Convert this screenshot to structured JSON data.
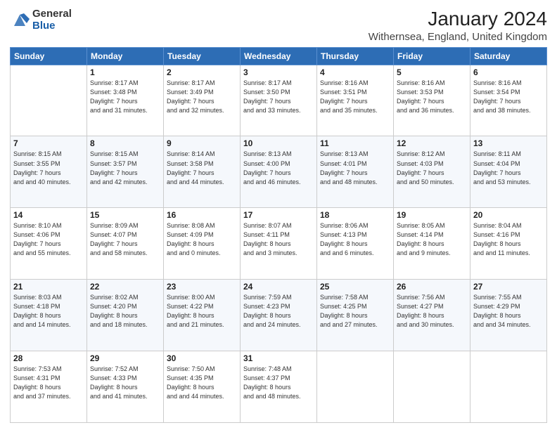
{
  "header": {
    "logo_general": "General",
    "logo_blue": "Blue",
    "month_year": "January 2024",
    "location": "Withernsea, England, United Kingdom"
  },
  "weekdays": [
    "Sunday",
    "Monday",
    "Tuesday",
    "Wednesday",
    "Thursday",
    "Friday",
    "Saturday"
  ],
  "weeks": [
    [
      {
        "day": "",
        "sunrise": "",
        "sunset": "",
        "daylight": ""
      },
      {
        "day": "1",
        "sunrise": "Sunrise: 8:17 AM",
        "sunset": "Sunset: 3:48 PM",
        "daylight": "Daylight: 7 hours and 31 minutes."
      },
      {
        "day": "2",
        "sunrise": "Sunrise: 8:17 AM",
        "sunset": "Sunset: 3:49 PM",
        "daylight": "Daylight: 7 hours and 32 minutes."
      },
      {
        "day": "3",
        "sunrise": "Sunrise: 8:17 AM",
        "sunset": "Sunset: 3:50 PM",
        "daylight": "Daylight: 7 hours and 33 minutes."
      },
      {
        "day": "4",
        "sunrise": "Sunrise: 8:16 AM",
        "sunset": "Sunset: 3:51 PM",
        "daylight": "Daylight: 7 hours and 35 minutes."
      },
      {
        "day": "5",
        "sunrise": "Sunrise: 8:16 AM",
        "sunset": "Sunset: 3:53 PM",
        "daylight": "Daylight: 7 hours and 36 minutes."
      },
      {
        "day": "6",
        "sunrise": "Sunrise: 8:16 AM",
        "sunset": "Sunset: 3:54 PM",
        "daylight": "Daylight: 7 hours and 38 minutes."
      }
    ],
    [
      {
        "day": "7",
        "sunrise": "Sunrise: 8:15 AM",
        "sunset": "Sunset: 3:55 PM",
        "daylight": "Daylight: 7 hours and 40 minutes."
      },
      {
        "day": "8",
        "sunrise": "Sunrise: 8:15 AM",
        "sunset": "Sunset: 3:57 PM",
        "daylight": "Daylight: 7 hours and 42 minutes."
      },
      {
        "day": "9",
        "sunrise": "Sunrise: 8:14 AM",
        "sunset": "Sunset: 3:58 PM",
        "daylight": "Daylight: 7 hours and 44 minutes."
      },
      {
        "day": "10",
        "sunrise": "Sunrise: 8:13 AM",
        "sunset": "Sunset: 4:00 PM",
        "daylight": "Daylight: 7 hours and 46 minutes."
      },
      {
        "day": "11",
        "sunrise": "Sunrise: 8:13 AM",
        "sunset": "Sunset: 4:01 PM",
        "daylight": "Daylight: 7 hours and 48 minutes."
      },
      {
        "day": "12",
        "sunrise": "Sunrise: 8:12 AM",
        "sunset": "Sunset: 4:03 PM",
        "daylight": "Daylight: 7 hours and 50 minutes."
      },
      {
        "day": "13",
        "sunrise": "Sunrise: 8:11 AM",
        "sunset": "Sunset: 4:04 PM",
        "daylight": "Daylight: 7 hours and 53 minutes."
      }
    ],
    [
      {
        "day": "14",
        "sunrise": "Sunrise: 8:10 AM",
        "sunset": "Sunset: 4:06 PM",
        "daylight": "Daylight: 7 hours and 55 minutes."
      },
      {
        "day": "15",
        "sunrise": "Sunrise: 8:09 AM",
        "sunset": "Sunset: 4:07 PM",
        "daylight": "Daylight: 7 hours and 58 minutes."
      },
      {
        "day": "16",
        "sunrise": "Sunrise: 8:08 AM",
        "sunset": "Sunset: 4:09 PM",
        "daylight": "Daylight: 8 hours and 0 minutes."
      },
      {
        "day": "17",
        "sunrise": "Sunrise: 8:07 AM",
        "sunset": "Sunset: 4:11 PM",
        "daylight": "Daylight: 8 hours and 3 minutes."
      },
      {
        "day": "18",
        "sunrise": "Sunrise: 8:06 AM",
        "sunset": "Sunset: 4:13 PM",
        "daylight": "Daylight: 8 hours and 6 minutes."
      },
      {
        "day": "19",
        "sunrise": "Sunrise: 8:05 AM",
        "sunset": "Sunset: 4:14 PM",
        "daylight": "Daylight: 8 hours and 9 minutes."
      },
      {
        "day": "20",
        "sunrise": "Sunrise: 8:04 AM",
        "sunset": "Sunset: 4:16 PM",
        "daylight": "Daylight: 8 hours and 11 minutes."
      }
    ],
    [
      {
        "day": "21",
        "sunrise": "Sunrise: 8:03 AM",
        "sunset": "Sunset: 4:18 PM",
        "daylight": "Daylight: 8 hours and 14 minutes."
      },
      {
        "day": "22",
        "sunrise": "Sunrise: 8:02 AM",
        "sunset": "Sunset: 4:20 PM",
        "daylight": "Daylight: 8 hours and 18 minutes."
      },
      {
        "day": "23",
        "sunrise": "Sunrise: 8:00 AM",
        "sunset": "Sunset: 4:22 PM",
        "daylight": "Daylight: 8 hours and 21 minutes."
      },
      {
        "day": "24",
        "sunrise": "Sunrise: 7:59 AM",
        "sunset": "Sunset: 4:23 PM",
        "daylight": "Daylight: 8 hours and 24 minutes."
      },
      {
        "day": "25",
        "sunrise": "Sunrise: 7:58 AM",
        "sunset": "Sunset: 4:25 PM",
        "daylight": "Daylight: 8 hours and 27 minutes."
      },
      {
        "day": "26",
        "sunrise": "Sunrise: 7:56 AM",
        "sunset": "Sunset: 4:27 PM",
        "daylight": "Daylight: 8 hours and 30 minutes."
      },
      {
        "day": "27",
        "sunrise": "Sunrise: 7:55 AM",
        "sunset": "Sunset: 4:29 PM",
        "daylight": "Daylight: 8 hours and 34 minutes."
      }
    ],
    [
      {
        "day": "28",
        "sunrise": "Sunrise: 7:53 AM",
        "sunset": "Sunset: 4:31 PM",
        "daylight": "Daylight: 8 hours and 37 minutes."
      },
      {
        "day": "29",
        "sunrise": "Sunrise: 7:52 AM",
        "sunset": "Sunset: 4:33 PM",
        "daylight": "Daylight: 8 hours and 41 minutes."
      },
      {
        "day": "30",
        "sunrise": "Sunrise: 7:50 AM",
        "sunset": "Sunset: 4:35 PM",
        "daylight": "Daylight: 8 hours and 44 minutes."
      },
      {
        "day": "31",
        "sunrise": "Sunrise: 7:48 AM",
        "sunset": "Sunset: 4:37 PM",
        "daylight": "Daylight: 8 hours and 48 minutes."
      },
      {
        "day": "",
        "sunrise": "",
        "sunset": "",
        "daylight": ""
      },
      {
        "day": "",
        "sunrise": "",
        "sunset": "",
        "daylight": ""
      },
      {
        "day": "",
        "sunrise": "",
        "sunset": "",
        "daylight": ""
      }
    ]
  ]
}
